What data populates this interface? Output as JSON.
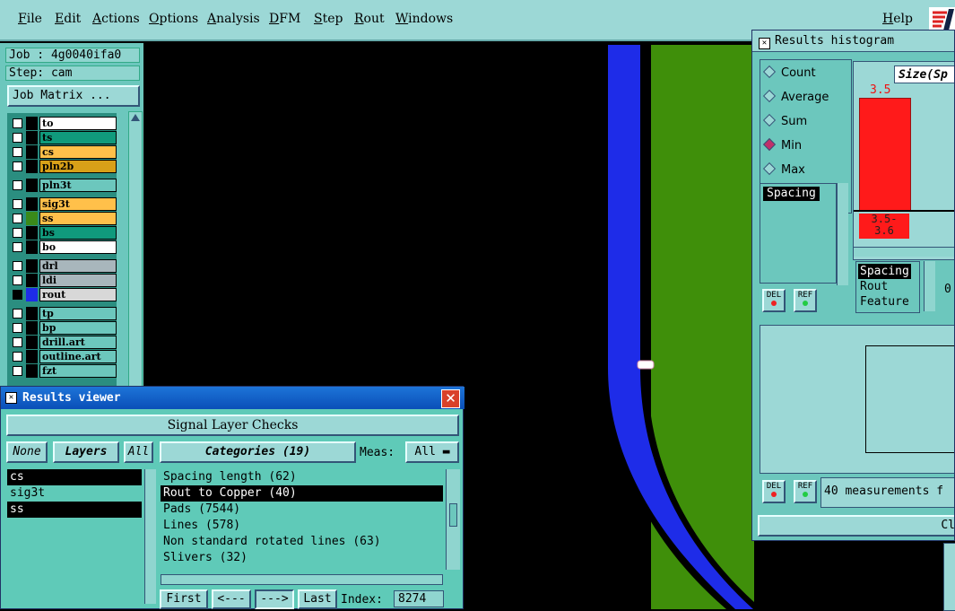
{
  "menubar": {
    "items": [
      "File",
      "Edit",
      "Actions",
      "Options",
      "Analysis",
      "DFM",
      "Step",
      "Rout",
      "Windows"
    ],
    "help": "Help"
  },
  "job": {
    "job_line": "Job : 4g0040ifa0",
    "step_line": "Step: cam",
    "matrix_button": "Job Matrix ..."
  },
  "layers": [
    {
      "name": "to",
      "color": "#ffffff"
    },
    {
      "name": "ts",
      "color": "#109a7c"
    },
    {
      "name": "cs",
      "color": "#ffc04a"
    },
    {
      "name": "pln2b",
      "color": "#d8a018"
    },
    {
      "name": "pln3t",
      "color": "#6cc7bd"
    },
    {
      "name": "sig3t",
      "color": "#ffc04a"
    },
    {
      "name": "ss",
      "color": "#ffc04a"
    },
    {
      "name": "bs",
      "color": "#109a7c"
    },
    {
      "name": "bo",
      "color": "#ffffff"
    },
    {
      "name": "drl",
      "color": "#a8b6bc"
    },
    {
      "name": "ldi",
      "color": "#a8b6bc"
    },
    {
      "name": "rout",
      "color": "#d8d8d8"
    },
    {
      "name": "tp",
      "color": "#6cc7bd"
    },
    {
      "name": "bp",
      "color": "#6cc7bd"
    },
    {
      "name": "drill.art",
      "color": "#6cc7bd"
    },
    {
      "name": "outline.art",
      "color": "#6cc7bd"
    },
    {
      "name": "fzt",
      "color": "#6cc7bd"
    }
  ],
  "results_viewer": {
    "title": "Results viewer",
    "section": "Signal Layer Checks",
    "none_button": "None",
    "layers_button": "Layers",
    "all_button": "All",
    "layer_list": [
      "cs",
      "sig3t",
      "ss"
    ],
    "categories_button": "Categories (19)",
    "meas_label": "Meas:",
    "meas_value": "All",
    "categories": [
      "Spacing length (62)",
      "Rout to Copper (40)",
      "Pads (7544)",
      "Lines (578)",
      "Non standard rotated lines (63)",
      "Slivers (32)"
    ],
    "selected_category": 1,
    "first_button": "First",
    "prev_button": "<---",
    "next_button": "--->",
    "last_button": "Last",
    "index_label": "Index:",
    "index_value": "8274"
  },
  "histogram": {
    "title": "Results histogram",
    "modes": [
      "Count",
      "Average",
      "Sum",
      "Min",
      "Max"
    ],
    "selected_mode": "Min",
    "measure_list": [
      "Spacing"
    ],
    "chart_title": "Size(Sp",
    "bar_value": "3.5",
    "bar_range": "3.5-\n3.6",
    "attr_list": [
      "Spacing",
      "Rout",
      "Feature"
    ],
    "partial_value": "0.",
    "del_label": "DEL",
    "ref_label": "REF",
    "measurements_text": "40 measurements f",
    "close_label": "Cl"
  },
  "colors": {
    "menubar": "#9cd8d6",
    "panel": "#6cc7bd",
    "rout_path": "#1e2ce8",
    "copper": "#3f8f0a",
    "histogram_bar": "#ff1a1a"
  }
}
